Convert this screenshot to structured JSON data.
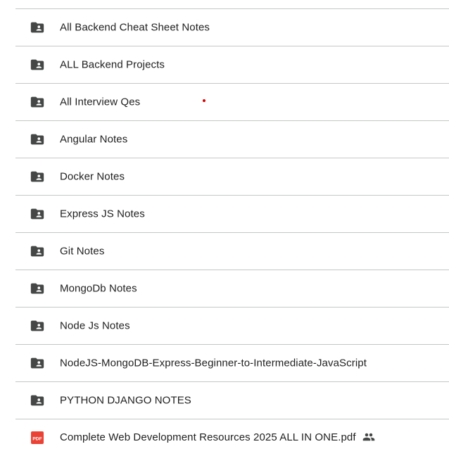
{
  "items": [
    {
      "name": "All Backend Cheat Sheet Notes",
      "icon": "shared-folder-icon"
    },
    {
      "name": "ALL Backend Projects",
      "icon": "shared-folder-icon"
    },
    {
      "name": "All Interview Qes",
      "icon": "shared-folder-icon"
    },
    {
      "name": "Angular Notes",
      "icon": "shared-folder-icon"
    },
    {
      "name": "Docker Notes",
      "icon": "shared-folder-icon"
    },
    {
      "name": "Express JS Notes",
      "icon": "shared-folder-icon"
    },
    {
      "name": "Git Notes",
      "icon": "shared-folder-icon"
    },
    {
      "name": "MongoDb Notes",
      "icon": "shared-folder-icon"
    },
    {
      "name": "Node Js Notes",
      "icon": "shared-folder-icon"
    },
    {
      "name": "NodeJS-MongoDB-Express-Beginner-to-Intermediate-JavaScript",
      "icon": "shared-folder-icon"
    },
    {
      "name": "PYTHON DJANGO NOTES",
      "icon": "shared-folder-icon"
    },
    {
      "name": "Complete Web Development Resources 2025 ALL IN ONE.pdf",
      "icon": "pdf-icon",
      "badge": "PDF",
      "shared_indicator": "people-icon"
    }
  ],
  "colors": {
    "folder_icon": "#444746",
    "pdf_icon": "#ea4335",
    "text": "#1f1f1f",
    "divider": "#c4c7c5",
    "dot": "#d50000"
  }
}
